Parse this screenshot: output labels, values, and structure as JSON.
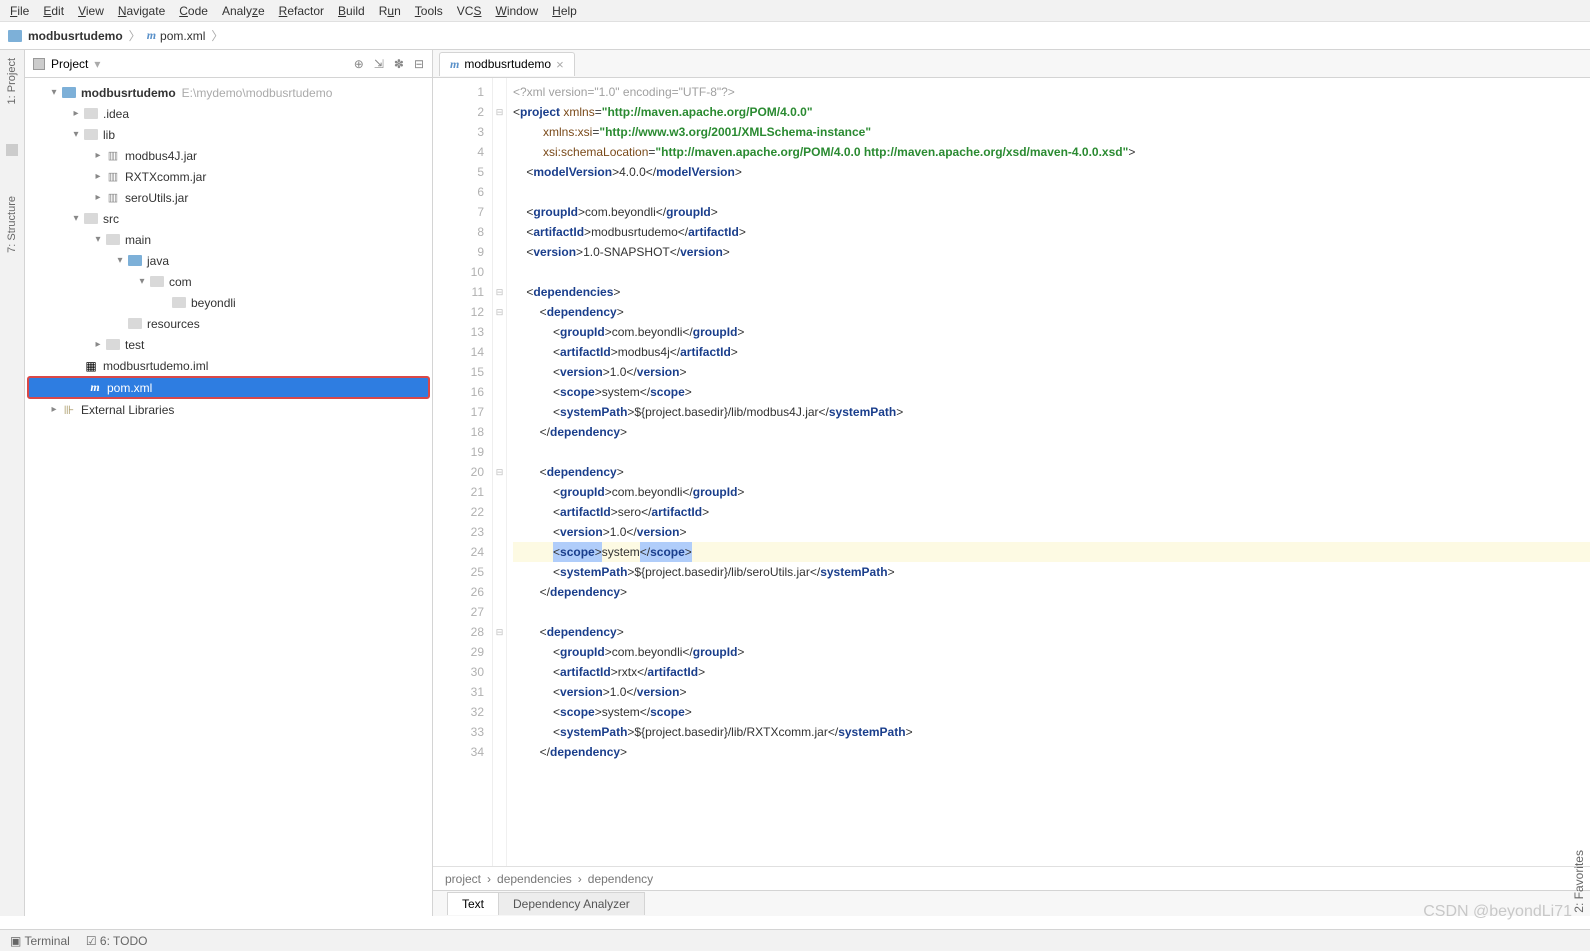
{
  "menu": {
    "file": "File",
    "edit": "Edit",
    "view": "View",
    "navigate": "Navigate",
    "code": "Code",
    "analyze": "Analyze",
    "refactor": "Refactor",
    "build": "Build",
    "run": "Run",
    "tools": "Tools",
    "vcs": "VCS",
    "window": "Window",
    "help": "Help"
  },
  "breadcrumb": {
    "project": "modbusrtudemo",
    "file": "pom.xml"
  },
  "sidebar": {
    "project": "1: Project",
    "structure": "7: Structure",
    "favorites": "2: Favorites"
  },
  "projectPane": {
    "title": "Project",
    "root": "modbusrtudemo",
    "rootPath": "E:\\mydemo\\modbusrtudemo",
    "nodes": {
      "idea": ".idea",
      "lib": "lib",
      "jar1": "modbus4J.jar",
      "jar2": "RXTXcomm.jar",
      "jar3": "seroUtils.jar",
      "src": "src",
      "main": "main",
      "java": "java",
      "com": "com",
      "beyondli": "beyondli",
      "resources": "resources",
      "test": "test",
      "iml": "modbusrtudemo.iml",
      "pom": "pom.xml",
      "extlib": "External Libraries"
    }
  },
  "editorTab": "modbusrtudemo",
  "lineNumbers": [
    "1",
    "2",
    "3",
    "4",
    "5",
    "6",
    "7",
    "8",
    "9",
    "10",
    "11",
    "12",
    "13",
    "14",
    "15",
    "16",
    "17",
    "18",
    "19",
    "20",
    "21",
    "22",
    "23",
    "24",
    "25",
    "26",
    "27",
    "28",
    "29",
    "30",
    "31",
    "32",
    "33",
    "34"
  ],
  "code": {
    "l1": {
      "decl": "<?xml version=\"1.0\" encoding=\"UTF-8\"?>"
    },
    "l2": {
      "tag": "project",
      "a1": "xmlns",
      "v1": "http://maven.apache.org/POM/4.0.0"
    },
    "l3": {
      "a": "xmlns:xsi",
      "v": "http://www.w3.org/2001/XMLSchema-instance"
    },
    "l4": {
      "a": "xsi:schemaLocation",
      "v": "http://maven.apache.org/POM/4.0.0 http://maven.apache.org/xsd/maven-4.0.0.xsd"
    },
    "l5": {
      "tag": "modelVersion",
      "txt": "4.0.0"
    },
    "l7": {
      "tag": "groupId",
      "txt": "com.beyondli"
    },
    "l8": {
      "tag": "artifactId",
      "txt": "modbusrtudemo"
    },
    "l9": {
      "tag": "version",
      "txt": "1.0-SNAPSHOT"
    },
    "l11": {
      "tag": "dependencies"
    },
    "l12": {
      "tag": "dependency"
    },
    "l13": {
      "tag": "groupId",
      "txt": "com.beyondli"
    },
    "l14": {
      "tag": "artifactId",
      "txt": "modbus4j"
    },
    "l15": {
      "tag": "version",
      "txt": "1.0"
    },
    "l16": {
      "tag": "scope",
      "txt": "system"
    },
    "l17": {
      "tag": "systemPath",
      "txt": "${project.basedir}/lib/modbus4J.jar"
    },
    "l18": {
      "ctag": "dependency"
    },
    "l20": {
      "tag": "dependency"
    },
    "l21": {
      "tag": "groupId",
      "txt": "com.beyondli"
    },
    "l22": {
      "tag": "artifactId",
      "txt": "sero"
    },
    "l23": {
      "tag": "version",
      "txt": "1.0"
    },
    "l24": {
      "tag": "scope",
      "txt": "system"
    },
    "l25": {
      "tag": "systemPath",
      "txt": "${project.basedir}/lib/seroUtils.jar"
    },
    "l26": {
      "ctag": "dependency"
    },
    "l28": {
      "tag": "dependency"
    },
    "l29": {
      "tag": "groupId",
      "txt": "com.beyondli"
    },
    "l30": {
      "tag": "artifactId",
      "txt": "rxtx"
    },
    "l31": {
      "tag": "version",
      "txt": "1.0"
    },
    "l32": {
      "tag": "scope",
      "txt": "system"
    },
    "l33": {
      "tag": "systemPath",
      "txt": "${project.basedir}/lib/RXTXcomm.jar"
    },
    "l34": {
      "ctag": "dependency"
    }
  },
  "editorBreadcrumb": {
    "p1": "project",
    "p2": "dependencies",
    "p3": "dependency"
  },
  "bottomTabs": {
    "text": "Text",
    "analyzer": "Dependency Analyzer"
  },
  "status": {
    "terminal": "Terminal",
    "todo": "6: TODO"
  },
  "watermark": "CSDN @beyondLi71"
}
